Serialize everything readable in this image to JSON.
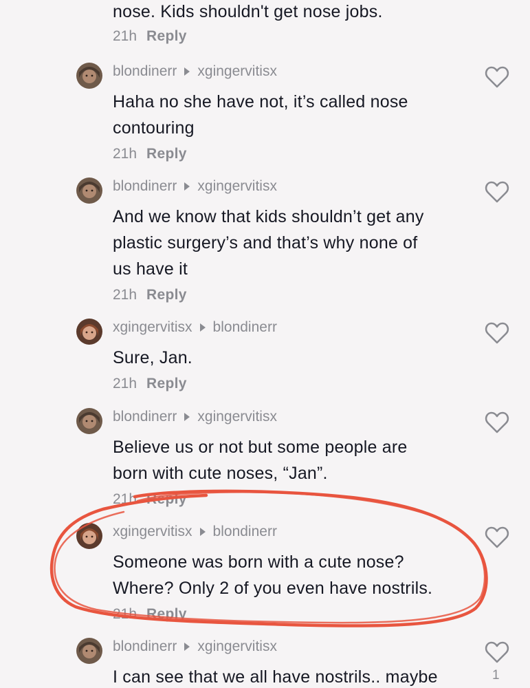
{
  "top_fragment": {
    "text": "nose. Kids shouldn't get nose jobs.",
    "time": "21h",
    "reply": "Reply"
  },
  "comments": [
    {
      "author": "blondinerr",
      "reply_to": "xgingervitisx",
      "lines": [
        "Haha no she have not, it’s called nose",
        "contouring"
      ],
      "time": "21h",
      "reply": "Reply"
    },
    {
      "author": "blondinerr",
      "reply_to": "xgingervitisx",
      "lines": [
        "And we know that kids shouldn’t get any",
        "plastic surgery’s and that’s why none of",
        "us have it"
      ],
      "time": "21h",
      "reply": "Reply"
    },
    {
      "author": "xgingervitisx",
      "reply_to": "blondinerr",
      "lines": [
        "Sure, Jan."
      ],
      "time": "21h",
      "reply": "Reply"
    },
    {
      "author": "blondinerr",
      "reply_to": "xgingervitisx",
      "lines": [
        "Believe us or not but some people are",
        "born with cute noses, “Jan”."
      ],
      "time": "21h",
      "reply": "Reply"
    },
    {
      "author": "xgingervitisx",
      "reply_to": "blondinerr",
      "lines": [
        "Someone was born with a cute nose?",
        "Where? Only 2 of you even have nostrils."
      ],
      "time": "21h",
      "reply": "Reply"
    },
    {
      "author": "blondinerr",
      "reply_to": "xgingervitisx",
      "lines": [
        "I can see that we all have nostrils.. maybe"
      ],
      "like_count": "1"
    }
  ],
  "icons": {
    "like": "heart-outline-icon",
    "reply_arrow": "triangle-right-icon"
  },
  "colors": {
    "background": "#f6f4f5",
    "text": "#161823",
    "muted": "#8a8b91",
    "highlight": "#e8553f"
  }
}
